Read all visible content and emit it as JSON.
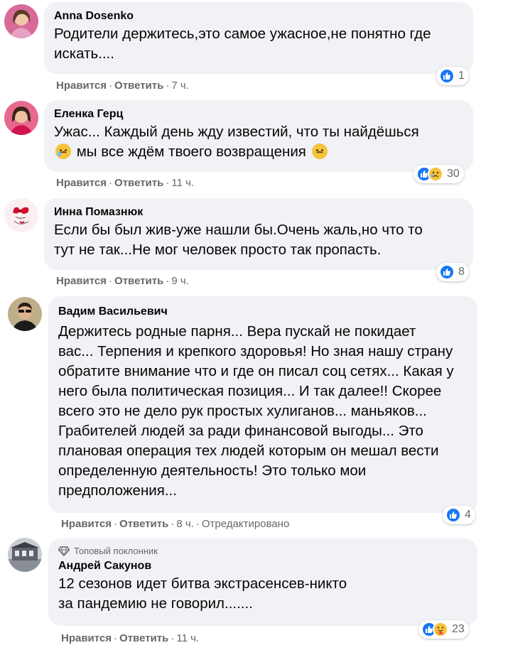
{
  "ui": {
    "like_label": "Нравится",
    "reply_label": "Ответить",
    "dot": "·"
  },
  "comments": [
    {
      "author": "Anna Dosenko",
      "text": "Родители держитесь,это самое ужасное,не понятно где искать....",
      "time": "7 ч.",
      "reactions": {
        "icons": [
          "like"
        ],
        "count": "1"
      }
    },
    {
      "author": "Еленка Герц",
      "text_parts": [
        "Ужас... Каждый день жду известий, что ты найдёшься",
        "мы все ждём твоего возвращения"
      ],
      "time": "11 ч.",
      "reactions": {
        "icons": [
          "like",
          "sad"
        ],
        "count": "30"
      }
    },
    {
      "author": "Инна Помазнюк",
      "text": "Если бы был жив-уже нашли бы.Очень жаль,но что то тут не так...Не мог человек просто так пропасть.",
      "time": "9 ч.",
      "reactions": {
        "icons": [
          "like"
        ],
        "count": "8"
      }
    },
    {
      "author": "Вадим Васильевич",
      "text": "Держитесь родные парня... Вера пускай не покидает вас... Терпения и крепкого здоровья! Но зная нашу страну обратите внимание что и где он писал соц сетях... Какая у него была политическая позиция... И так далее!! Скорее всего это не дело рук простых хулиганов... маньяков... Грабителей людей за ради финансовой выгоды... Это плановая операция тех людей которым он мешал вести определенную деятельность! Это только мои предположения...",
      "time": "8 ч.",
      "edited": "Отредактировано",
      "reactions": {
        "icons": [
          "like"
        ],
        "count": "4"
      }
    },
    {
      "badge": "Топовый поклонник",
      "author": "Андрей Сакунов",
      "text": "12 сезонов идет битва экстрасенсев-никто за пандемию не говорил.......",
      "time": "11 ч.",
      "reactions": {
        "icons": [
          "like",
          "care"
        ],
        "count": "23"
      }
    }
  ],
  "colors": {
    "bubble": "#f0f2f5",
    "secondary_text": "#65676b",
    "like_blue": "#1877f2",
    "emoji_yellow": "#f7c33b"
  },
  "icons": [
    "like-icon",
    "sad-icon",
    "care-icon",
    "diamond-icon",
    "avatar"
  ]
}
